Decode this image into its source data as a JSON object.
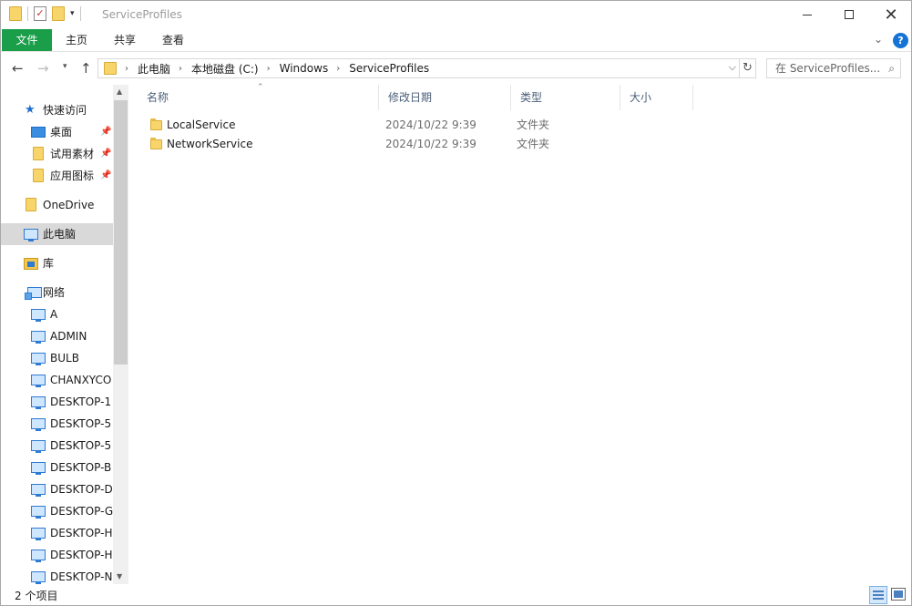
{
  "window": {
    "title": "ServiceProfiles",
    "minimize_glyph": "",
    "maximize_glyph": "",
    "close_glyph": "✕"
  },
  "ribbon": {
    "tabs": [
      {
        "label": "文件"
      },
      {
        "label": "主页"
      },
      {
        "label": "共享"
      },
      {
        "label": "查看"
      }
    ],
    "expand_glyph": "⌄",
    "help_glyph": "?"
  },
  "address": {
    "crumbs": [
      "此电脑",
      "本地磁盘 (C:)",
      "Windows",
      "ServiceProfiles"
    ],
    "search_placeholder": "在 ServiceProfiles..."
  },
  "nav": {
    "quick_access": "快速访问",
    "pinned": [
      {
        "label": "桌面"
      },
      {
        "label": "试用素材"
      },
      {
        "label": "应用图标"
      }
    ],
    "onedrive": "OneDrive",
    "this_pc": "此电脑",
    "library": "库",
    "network": "网络",
    "network_items": [
      {
        "label": "A"
      },
      {
        "label": "ADMIN"
      },
      {
        "label": "BULB"
      },
      {
        "label": "CHANXYCO"
      },
      {
        "label": "DESKTOP-1"
      },
      {
        "label": "DESKTOP-5"
      },
      {
        "label": "DESKTOP-5"
      },
      {
        "label": "DESKTOP-B"
      },
      {
        "label": "DESKTOP-D"
      },
      {
        "label": "DESKTOP-G"
      },
      {
        "label": "DESKTOP-H"
      },
      {
        "label": "DESKTOP-H"
      },
      {
        "label": "DESKTOP-N"
      }
    ]
  },
  "list": {
    "columns": {
      "name": "名称",
      "date": "修改日期",
      "type": "类型",
      "size": "大小"
    },
    "rows": [
      {
        "name": "LocalService",
        "date": "2024/10/22 9:39",
        "type": "文件夹"
      },
      {
        "name": "NetworkService",
        "date": "2024/10/22 9:39",
        "type": "文件夹"
      }
    ]
  },
  "status": {
    "count_text": "2 个项目"
  },
  "icons": {
    "accent": "#1a9e4a",
    "help": "#1673d6",
    "folder": "#f8d56b"
  }
}
